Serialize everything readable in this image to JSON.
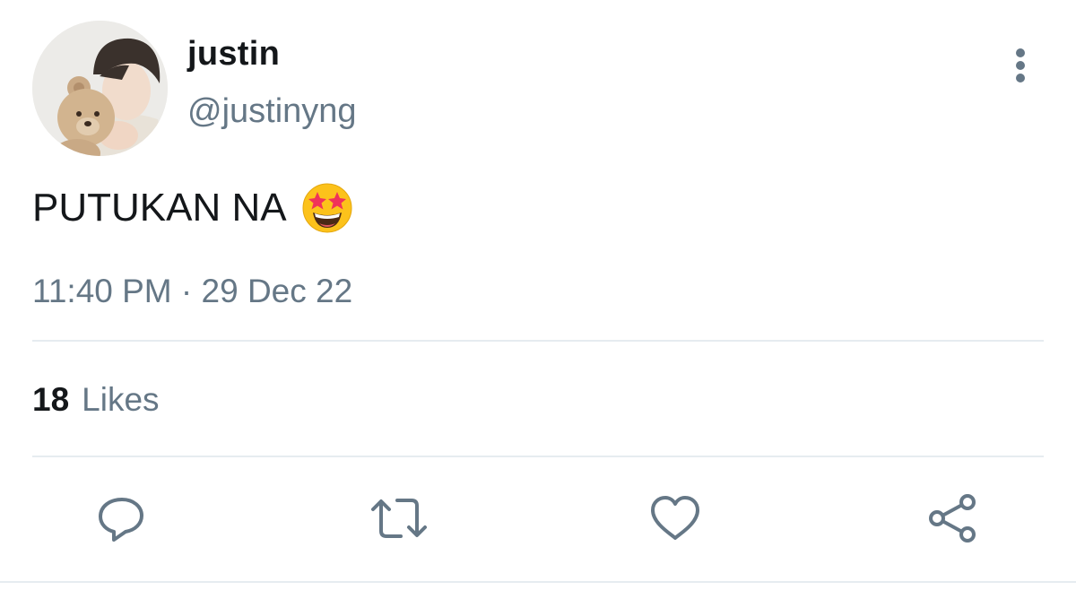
{
  "user": {
    "display_name": "justin",
    "handle": "@justinyng"
  },
  "tweet": {
    "text": "PUTUKAN NA",
    "emoji": "star-struck-emoji",
    "timestamp": "11:40 PM · 29 Dec 22"
  },
  "stats": {
    "likes_count": "18",
    "likes_label": "Likes"
  },
  "actions": {
    "reply": "reply-icon",
    "retweet": "retweet-icon",
    "like": "heart-icon",
    "share": "share-icon"
  },
  "colors": {
    "text_primary": "#14171a",
    "text_secondary": "#657786",
    "divider": "#e6ecf0",
    "icon": "#657786"
  }
}
